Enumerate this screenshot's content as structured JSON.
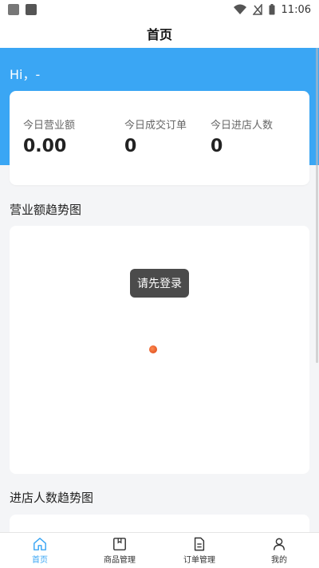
{
  "status_bar": {
    "time": "11:06"
  },
  "header": {
    "title": "首页"
  },
  "greeting": "Hi，-",
  "stats": [
    {
      "label": "今日营业额",
      "value": "0.00"
    },
    {
      "label": "今日成交订单",
      "value": "0"
    },
    {
      "label": "今日进店人数",
      "value": "0"
    }
  ],
  "sections": {
    "revenue_trend_title": "营业额趋势图",
    "visitors_trend_title": "进店人数趋势图"
  },
  "toast": "请先登录",
  "tabbar": {
    "items": [
      {
        "label": "首页",
        "icon": "home-icon",
        "active": true
      },
      {
        "label": "商品管理",
        "icon": "box-icon",
        "active": false
      },
      {
        "label": "订单管理",
        "icon": "document-icon",
        "active": false
      },
      {
        "label": "我的",
        "icon": "user-icon",
        "active": false
      }
    ]
  },
  "colors": {
    "accent": "#3aa6f4",
    "toast_bg": "#4b4b4b"
  }
}
